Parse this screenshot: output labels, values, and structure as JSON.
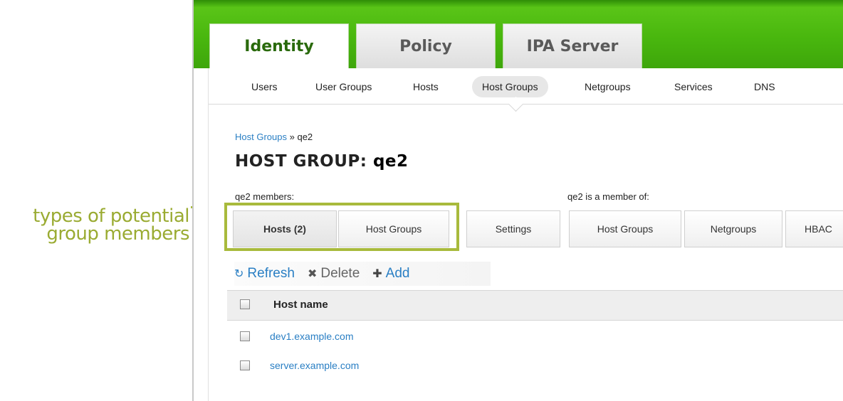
{
  "annotation": {
    "line1": "types of potential",
    "line2": "group members"
  },
  "main_tabs": [
    {
      "label": "Identity",
      "active": true
    },
    {
      "label": "Policy",
      "active": false
    },
    {
      "label": "IPA Server",
      "active": false
    }
  ],
  "subnav": [
    {
      "label": "Users"
    },
    {
      "label": "User Groups"
    },
    {
      "label": "Hosts"
    },
    {
      "label": "Host Groups",
      "active": true
    },
    {
      "label": "Netgroups"
    },
    {
      "label": "Services"
    },
    {
      "label": "DNS"
    }
  ],
  "breadcrumb": {
    "link": "Host Groups",
    "separator": "»",
    "current": "qe2"
  },
  "title": {
    "prefix": "HOST GROUP:",
    "name": "qe2"
  },
  "sections": {
    "members": "qe2 members:",
    "member_of": "qe2 is a member of:"
  },
  "facet_tabs": [
    {
      "label": "Hosts (2)",
      "active": true
    },
    {
      "label": "Host Groups"
    },
    {
      "label": "Settings"
    },
    {
      "label": "Host Groups"
    },
    {
      "label": "Netgroups"
    },
    {
      "label": "HBAC"
    }
  ],
  "actions": {
    "refresh": "Refresh",
    "delete": "Delete",
    "add": "Add"
  },
  "icons": {
    "refresh": "refresh-icon",
    "delete": "x-icon",
    "add": "plus-icon"
  },
  "table": {
    "column": "Host name",
    "rows": [
      "dev1.example.com",
      "server.example.com"
    ]
  },
  "colors": {
    "header_green": "#49b70e",
    "link_blue": "#2a7fc4",
    "annotation": "#9aab32"
  }
}
